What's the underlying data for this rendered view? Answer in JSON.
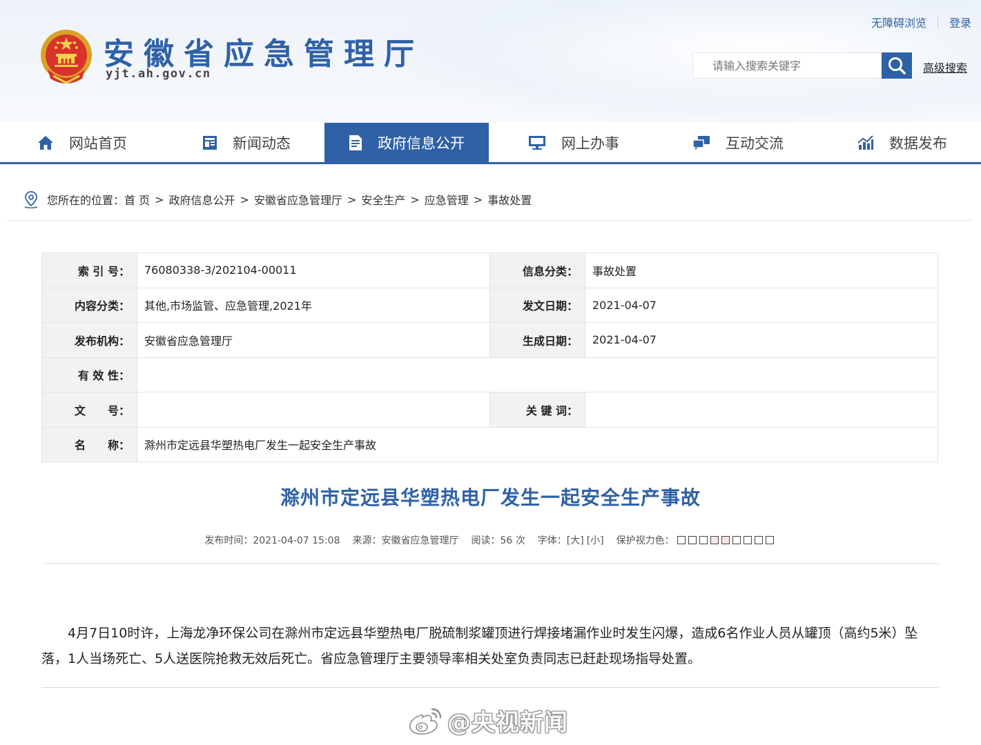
{
  "header": {
    "site_name": "安徽省应急管理厅",
    "site_domain": "yjt.ah.gov.cn",
    "top_links": {
      "accessible": "无障碍浏览",
      "login": "登录"
    },
    "search": {
      "placeholder": "请输入搜索关键字",
      "advanced_label": "高级搜索"
    }
  },
  "nav": {
    "items": [
      {
        "label": "网站首页",
        "icon": "home-icon"
      },
      {
        "label": "新闻动态",
        "icon": "news-icon"
      },
      {
        "label": "政府信息公开",
        "icon": "document-icon",
        "active": true
      },
      {
        "label": "网上办事",
        "icon": "monitor-icon"
      },
      {
        "label": "互动交流",
        "icon": "chat-icon"
      },
      {
        "label": "数据发布",
        "icon": "chart-icon"
      }
    ]
  },
  "breadcrumb": {
    "prefix": "您所在的位置：",
    "items": [
      "首 页",
      "政府信息公开",
      "安徽省应急管理厅",
      "安全生产",
      "应急管理",
      "事故处置"
    ],
    "separator": ">"
  },
  "meta": {
    "index_no": {
      "label": "索 引 号：",
      "value": "76080338-3/202104-00011"
    },
    "info_category": {
      "label": "信息分类：",
      "value": "事故处置"
    },
    "content_category": {
      "label": "内容分类：",
      "value": "其他,市场监管、应急管理,2021年"
    },
    "issue_date": {
      "label": "发文日期：",
      "value": "2021-04-07"
    },
    "publisher": {
      "label": "发布机构：",
      "value": "安徽省应急管理厅"
    },
    "created_date": {
      "label": "生成日期：",
      "value": "2021-04-07"
    },
    "validity": {
      "label": "有 效 性：",
      "value": ""
    },
    "doc_no": {
      "label": "文　　号：",
      "value": ""
    },
    "keywords": {
      "label": "关 键 词：",
      "value": ""
    },
    "name": {
      "label": "名　　称：",
      "value": "滁州市定远县华塑热电厂发生一起安全生产事故"
    }
  },
  "article": {
    "title": "滁州市定远县华塑热电厂发生一起安全生产事故",
    "publish_time": "发布时间：2021-04-07 15:08",
    "source": "来源：安徽省应急管理厅",
    "reads": "阅读：56 次",
    "font_label": "字体：",
    "font_large": "[大]",
    "font_small": "[小]",
    "eye_color_label": "保护视力色：",
    "eye_colors": [
      "#ffffff",
      "#ffffff",
      "#ffffff",
      "#fbe3e3",
      "#fbe3e3",
      "#ffffff",
      "#ffffff",
      "#ffffff",
      "#ffffff"
    ],
    "body": "4月7日10时许，上海龙净环保公司在滁州市定远县华塑热电厂脱硫制浆罐顶进行焊接堵漏作业时发生闪爆，造成6名作业人员从罐顶（高约5米）坠落，1人当场死亡、5人送医院抢救无效后死亡。省应急管理厅主要领导率相关处室负责同志已赶赴现场指导处置。"
  },
  "watermark": {
    "text": "@央视新闻",
    "icon": "weibo-icon"
  },
  "colors": {
    "brand": "#2f61a6",
    "label_bg": "#f2f2f2"
  }
}
